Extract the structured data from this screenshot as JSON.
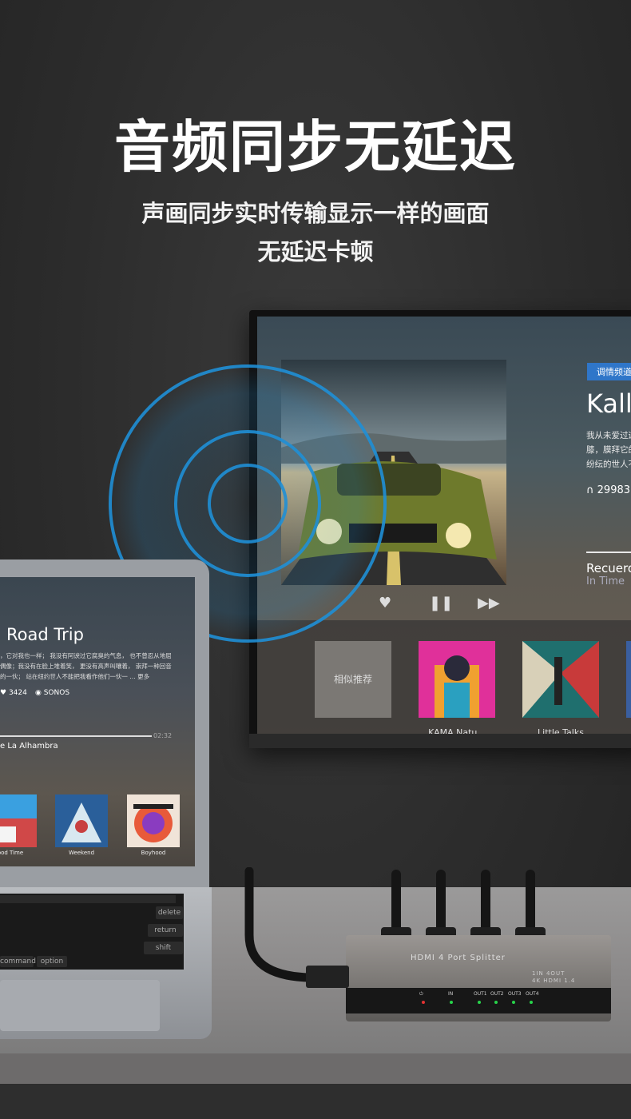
{
  "headline": "音频同步无延迟",
  "subline_1": "声画同步实时传输显示一样的画面",
  "subline_2": "无延迟卡顿",
  "tv": {
    "badge": "调情频道",
    "title": "Kalle",
    "desc_1": "我从未爱过这",
    "desc_2": "膝，膜拜它的",
    "desc_3": "纷纭的世人不",
    "listen_count": "29983",
    "song": "Recuerdo",
    "artist": "In Time",
    "shelf_label": "相似推荐",
    "tiles": [
      "KAMA Natu...",
      "Little Talks"
    ]
  },
  "laptop": {
    "title": "Road Trip",
    "desc_1": "，它对我也一样；  我没有阿谀过它腐臭的气息，  也不曾忍从地屈",
    "desc_2": "偶像；我没有在脸上堆着笑，  更没有高声叫嚷着，  崇拜一种回音；",
    "desc_3": "的一伙；  站在纽约世人不能把我看作他们一伙一 …  更多",
    "count": "3424",
    "brand": "SONOS",
    "time": "02:32",
    "song": "e La Alhambra",
    "tiles": [
      "ood Time",
      "Weekend",
      "Boyhood"
    ],
    "keys": [
      "delete",
      "return",
      "shift",
      "command",
      "option"
    ]
  },
  "splitter": {
    "title": "HDMI 4 Port Splitter",
    "model_1": "1IN 4OUT",
    "model_2": "4K HDMI 1.4",
    "ports": [
      "IN",
      "OUT1",
      "OUT2",
      "OUT3",
      "OUT4"
    ]
  },
  "colors": {
    "accent_blue": "#1f8fd6",
    "led_green": "#27d34a",
    "led_red": "#e23232"
  }
}
